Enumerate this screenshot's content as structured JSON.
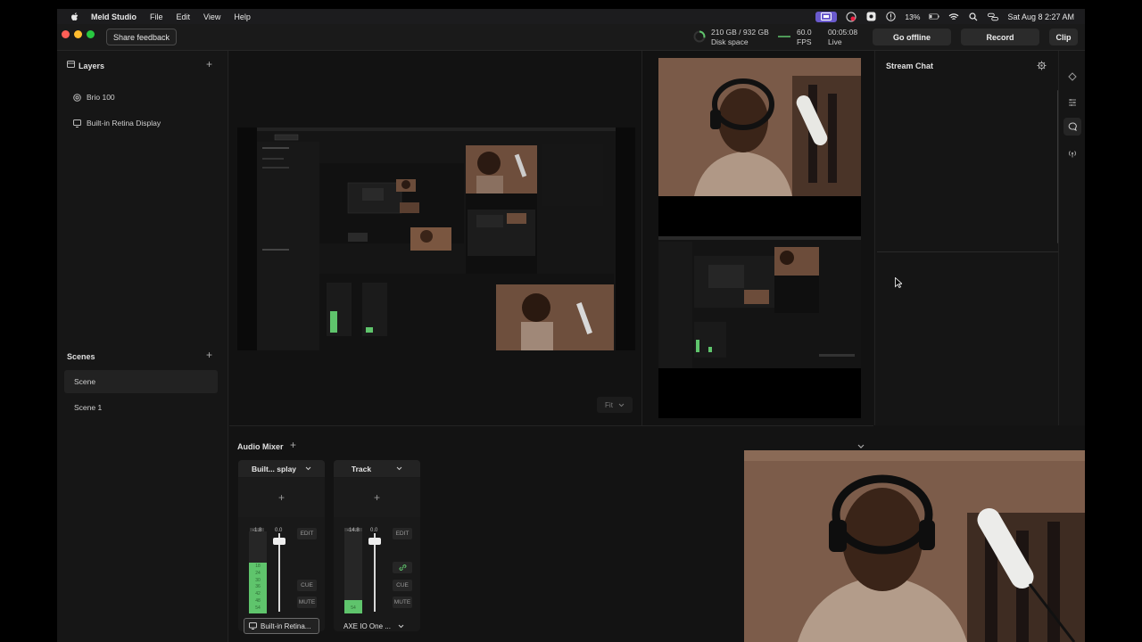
{
  "menubar": {
    "app": "Meld Studio",
    "menus": [
      "File",
      "Edit",
      "View",
      "Help"
    ],
    "battery": "13%",
    "datetime": "Sat Aug 8  2:27 AM"
  },
  "titlebar": {
    "share_feedback": "Share feedback",
    "disk_value": "210 GB / 932 GB",
    "disk_label": "Disk space",
    "fps_value": "60.0",
    "fps_label": "FPS",
    "live_time": "00:05:08",
    "live_label": "Live",
    "go_offline": "Go offline",
    "record": "Record",
    "clip": "Clip"
  },
  "layers": {
    "title": "Layers",
    "items": [
      {
        "label": "Brio 100",
        "icon": "camera-icon"
      },
      {
        "label": "Built-in Retina Display",
        "icon": "display-icon"
      }
    ]
  },
  "scenes": {
    "title": "Scenes",
    "items": [
      {
        "label": "Scene",
        "active": true
      },
      {
        "label": "Scene 1",
        "active": false
      }
    ]
  },
  "preview": {
    "fit_label": "Fit"
  },
  "chat": {
    "title": "Stream Chat"
  },
  "mixer": {
    "title": "Audio Mixer",
    "tracks": [
      {
        "name": "Built... splay",
        "level": "-1.8",
        "gain": "0.0",
        "edit": "EDIT",
        "cue": "CUE",
        "mute": "MUTE",
        "source": "Built-in Retina...",
        "meter_level": 0.62,
        "scale": [
          "18",
          "24",
          "30",
          "36",
          "42",
          "48",
          "54"
        ]
      },
      {
        "name": "Track",
        "level": "-14.8",
        "gain": "0.0",
        "edit": "EDIT",
        "cue": "CUE",
        "mute": "MUTE",
        "source": "AXE IO One ...",
        "meter_level": 0.16,
        "scale": [
          "54"
        ]
      }
    ]
  },
  "colors": {
    "accent": "#6a5acd",
    "meter_green": "#5fc46c",
    "close": "#ff5f57",
    "minimize": "#febc2e",
    "zoom": "#28c840"
  }
}
